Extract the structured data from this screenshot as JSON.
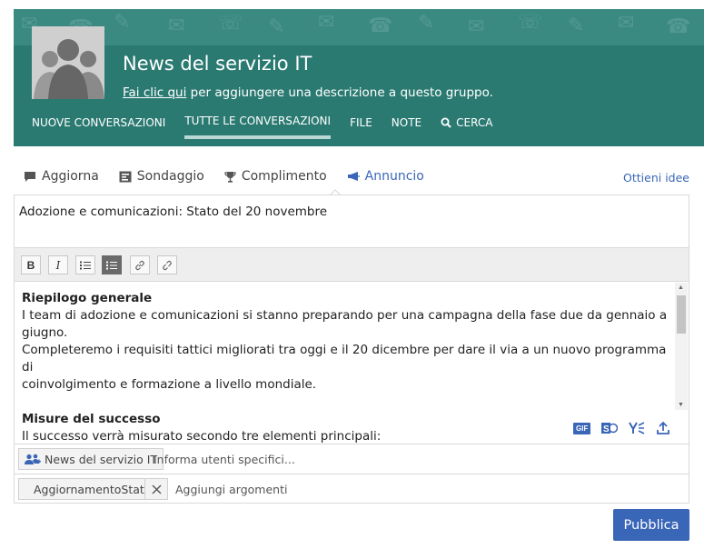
{
  "group": {
    "title": "News del servizio IT",
    "desc_link": "Fai clic qui",
    "desc_rest": " per aggiungere una descrizione a questo gruppo."
  },
  "nav": [
    {
      "label": "NUOVE CONVERSAZIONI"
    },
    {
      "label": "TUTTE LE CONVERSAZIONI",
      "active": true
    },
    {
      "label": "FILE"
    },
    {
      "label": "NOTE"
    },
    {
      "label": "CERCA",
      "icon": "search-icon"
    }
  ],
  "tabs": [
    {
      "label": "Aggiorna",
      "icon": "comment-icon"
    },
    {
      "label": "Sondaggio",
      "icon": "poll-icon"
    },
    {
      "label": "Complimento",
      "icon": "trophy-icon"
    },
    {
      "label": "Annuncio",
      "icon": "megaphone-icon",
      "active": true
    }
  ],
  "ideas_link": "Ottieni idee",
  "composer": {
    "subject": "Adozione e comunicazioni: Stato del 20 novembre",
    "toolbar": {
      "bold": "B",
      "italic": "I",
      "bullets_icon": "bullet-list-icon",
      "numbered_icon": "numbered-list-icon",
      "link_icon": "link-icon",
      "unlink_icon": "unlink-icon"
    },
    "body": {
      "heading1": "Riepilogo generale",
      "line1": "I team di adozione e comunicazioni si stanno preparando per una campagna della fase due da gennaio a giugno.",
      "line2": "Completeremo i requisiti tattici migliorati tra oggi e il 20 dicembre per dare il via a un nuovo programma di",
      "line3": "coinvolgimento e formazione a livello mondiale.",
      "heading2": "Misure del successo",
      "line4": "Il successo verrà misurato secondo tre elementi principali:"
    },
    "attachments": {
      "gif": "GIF",
      "sharepoint_icon": "sharepoint-icon",
      "yammer_icon": "yammer-icon",
      "upload_icon": "upload-icon"
    },
    "group_chip": "News del servizio IT",
    "notify_placeholder": "Informa utenti specifici...",
    "topic_chip": "AggiornamentoStato",
    "topic_placeholder": "Aggiungi argomenti"
  },
  "publish_label": "Pubblica",
  "colors": {
    "header": "#2b7a72",
    "accent": "#3a66b8"
  }
}
